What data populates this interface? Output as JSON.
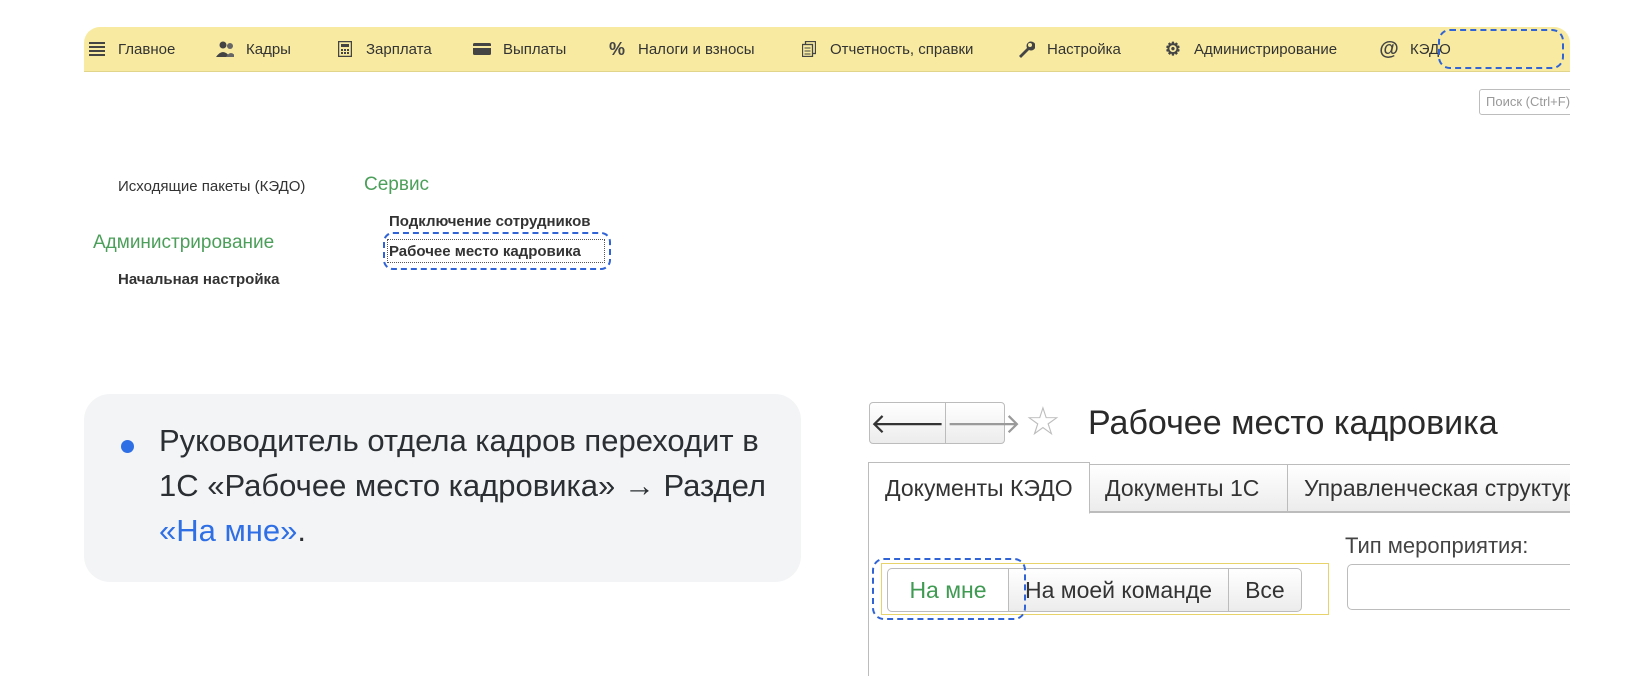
{
  "menubar": {
    "items": [
      {
        "label": "Главное",
        "icon": "menu-lines-icon"
      },
      {
        "label": "Кадры",
        "icon": "people-icon"
      },
      {
        "label": "Зарплата",
        "icon": "calculator-icon"
      },
      {
        "label": "Выплаты",
        "icon": "wallet-icon"
      },
      {
        "label": "Налоги и взносы",
        "icon": "percent-icon"
      },
      {
        "label": "Отчетность, справки",
        "icon": "reports-icon"
      },
      {
        "label": "Настройка",
        "icon": "wrench-icon"
      },
      {
        "label": "Администрирование",
        "icon": "gear-icon"
      },
      {
        "label": "КЭДО",
        "icon": "at-sign-icon"
      }
    ]
  },
  "search": {
    "placeholder": "Поиск (Ctrl+F)"
  },
  "section": {
    "outgoing_packages": "Исходящие пакеты (КЭДО)",
    "admin_title": "Администрирование",
    "initial_setup": "Начальная настройка",
    "service_title": "Сервис",
    "connect_employees": "Подключение сотрудников",
    "hr_workplace": "Рабочее место кадровика"
  },
  "note": {
    "text_before": "Руководитель отдела кадров переходит в 1С «Рабочее место кадровика» → Раздел ",
    "highlight": "«На мне»",
    "text_after": "."
  },
  "workplace": {
    "back_glyph": "🡐",
    "forward_glyph": "🡒",
    "star_glyph": "☆",
    "title": "Рабочее место кадровика",
    "tabs": [
      "Документы КЭДО",
      "Документы 1С",
      "Управленческая структура"
    ],
    "event_type_label": "Тип мероприятия:",
    "filters": [
      "На мне",
      "На моей команде",
      "Все"
    ]
  }
}
